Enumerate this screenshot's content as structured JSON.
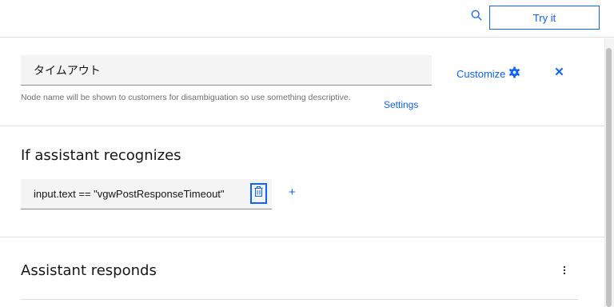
{
  "header": {
    "search_icon": "search-icon",
    "try_it_label": "Try it"
  },
  "node": {
    "name_value": "タイムアウト",
    "helper_text": "Node name will be shown to customers for disambiguation so use something descriptive.",
    "settings_label": "Settings",
    "customize_label": "Customize",
    "customize_icon": "gear-icon",
    "close_icon": "close-icon"
  },
  "recognizes": {
    "title": "If assistant recognizes",
    "condition_value": "input.text == \"vgwPostResponseTimeout\"",
    "delete_icon": "trash-icon",
    "add_label": "+"
  },
  "responds": {
    "title": "Assistant responds",
    "overflow_icon": "overflow-menu-icon"
  },
  "colors": {
    "accent": "#0f62fe",
    "field_bg": "#f4f4f4",
    "text_primary": "#161616",
    "text_helper": "#6f6f6f",
    "divider": "#e0e0e0"
  }
}
